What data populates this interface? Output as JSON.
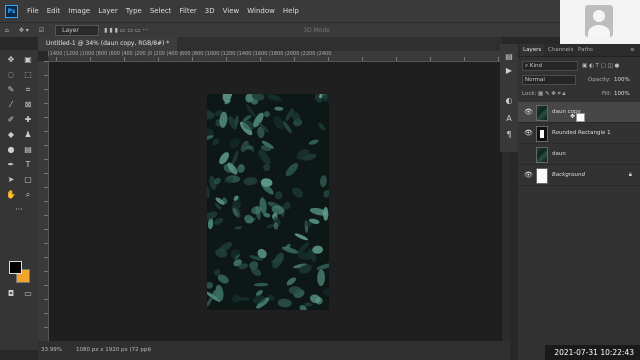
{
  "menu": [
    "File",
    "Edit",
    "Image",
    "Layer",
    "Type",
    "Select",
    "Filter",
    "3D",
    "View",
    "Window",
    "Help"
  ],
  "app_logo": "Ps",
  "options": {
    "auto_select_value": "Layer",
    "mode_3d": "3D Mode"
  },
  "document_tab": "Untitled-1 @ 34% (daun copy, RGB/8#) *",
  "ruler_labels": "|1400 |1200 |1000 |800 |600 |400 |200 |0 |200 |400 |600 |800 |1000 |1200 |1400 |1600 |1800 |2000 |2200 |2400",
  "status": {
    "zoom": "33.99%",
    "doc_info": "1080 px x 1920 px (72 ppi)"
  },
  "panel_tabs": [
    "Layers",
    "Channels",
    "Paths"
  ],
  "layers_controls": {
    "filter": "Kind",
    "blend_mode": "Normal",
    "opacity_label": "Opacity:",
    "opacity_value": "100%",
    "lock_label": "Lock:",
    "fill_label": "Fill:",
    "fill_value": "100%"
  },
  "layers": [
    {
      "name": "daun copy",
      "visible": true,
      "selected": true,
      "thumb": "leaf"
    },
    {
      "name": "Rounded Rectangle 1",
      "visible": true,
      "selected": false,
      "thumb": "rect"
    },
    {
      "name": "daun",
      "visible": false,
      "selected": false,
      "thumb": "leaf"
    },
    {
      "name": "Background",
      "visible": true,
      "selected": false,
      "thumb": "white",
      "locked": true
    }
  ],
  "timestamp": "2021-07-31  10:22:43",
  "colors": {
    "foreground": "#000000",
    "background": "#f0a52a",
    "accent": "#31a8ff"
  },
  "icons": [
    "home-icon",
    "move-icon",
    "eye-icon",
    "lock-icon",
    "paragraph-icon",
    "play-icon"
  ]
}
